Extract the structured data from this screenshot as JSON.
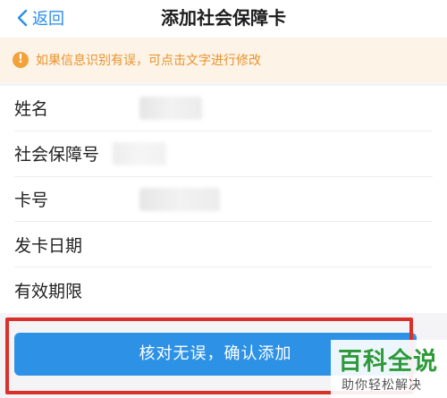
{
  "nav": {
    "back_label": "返回",
    "title": "添加社会保障卡"
  },
  "notice": {
    "icon": "warning-icon",
    "text": "如果信息识别有误，可点击文字进行修改",
    "color": "#e8932c"
  },
  "form": {
    "fields": [
      {
        "label": "姓名"
      },
      {
        "label": "社会保障号"
      },
      {
        "label": "卡号"
      },
      {
        "label": "发卡日期"
      },
      {
        "label": "有效期限"
      }
    ]
  },
  "confirm_button": {
    "label": "核对无误，确认添加",
    "color": "#2d92e6"
  },
  "watermark": {
    "main": "百科全说",
    "sub": "助你轻松解决"
  },
  "colors": {
    "accent": "#2a8ce8",
    "highlight_box": "#d9302a"
  }
}
